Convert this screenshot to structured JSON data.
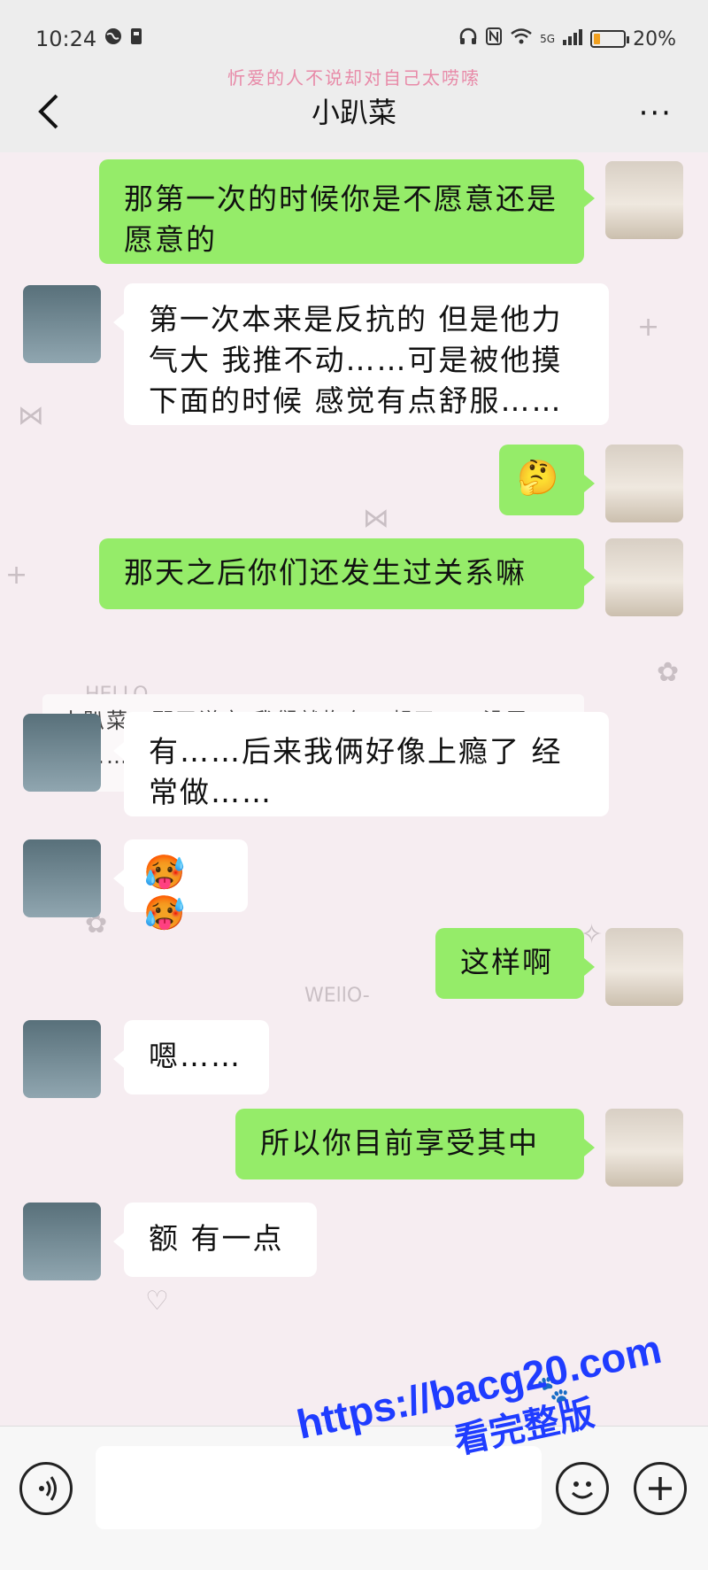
{
  "status_bar": {
    "time": "10:24",
    "battery": "20%",
    "battery_level": 0.2,
    "network": "5G"
  },
  "signature": "忻爱的人不说却对自己太唠嗦",
  "nav": {
    "title": "小趴菜",
    "more": "···"
  },
  "doodles": [
    "kitty",
    "HELLO",
    "WEllO-",
    "kitty"
  ],
  "messages": [
    {
      "side": "me",
      "text": "那第一次的时候你是不愿意还是愿意的"
    },
    {
      "side": "other",
      "text": "第一次本来是反抗的 但是他力气大 我推不动……可是被他摸下面的时候 感觉有点舒服……"
    },
    {
      "side": "me",
      "text": "🤔"
    },
    {
      "side": "me",
      "text": "那天之后你们还发生过关系嘛"
    },
    {
      "side": "other",
      "text": "有……后来我俩好像上瘾了 经常做……"
    },
    {
      "side": "other",
      "text": "🥵🥵"
    },
    {
      "side": "me",
      "text": "这样啊"
    },
    {
      "side": "other",
      "text": "嗯……"
    },
    {
      "side": "me",
      "text": "所以你目前享受其中"
    },
    {
      "side": "other",
      "text": "额 有一点"
    }
  ],
  "quote": {
    "text": "小趴菜：那天说完 我们就抱在一起了……没忍住……"
  },
  "input_bar": {
    "voice_icon": "voice-icon",
    "emoji_icon": "emoji-icon",
    "plus_icon": "plus-icon",
    "placeholder": ""
  },
  "watermark": {
    "line1": "https://bacg20.com",
    "line2": "看完整版"
  }
}
